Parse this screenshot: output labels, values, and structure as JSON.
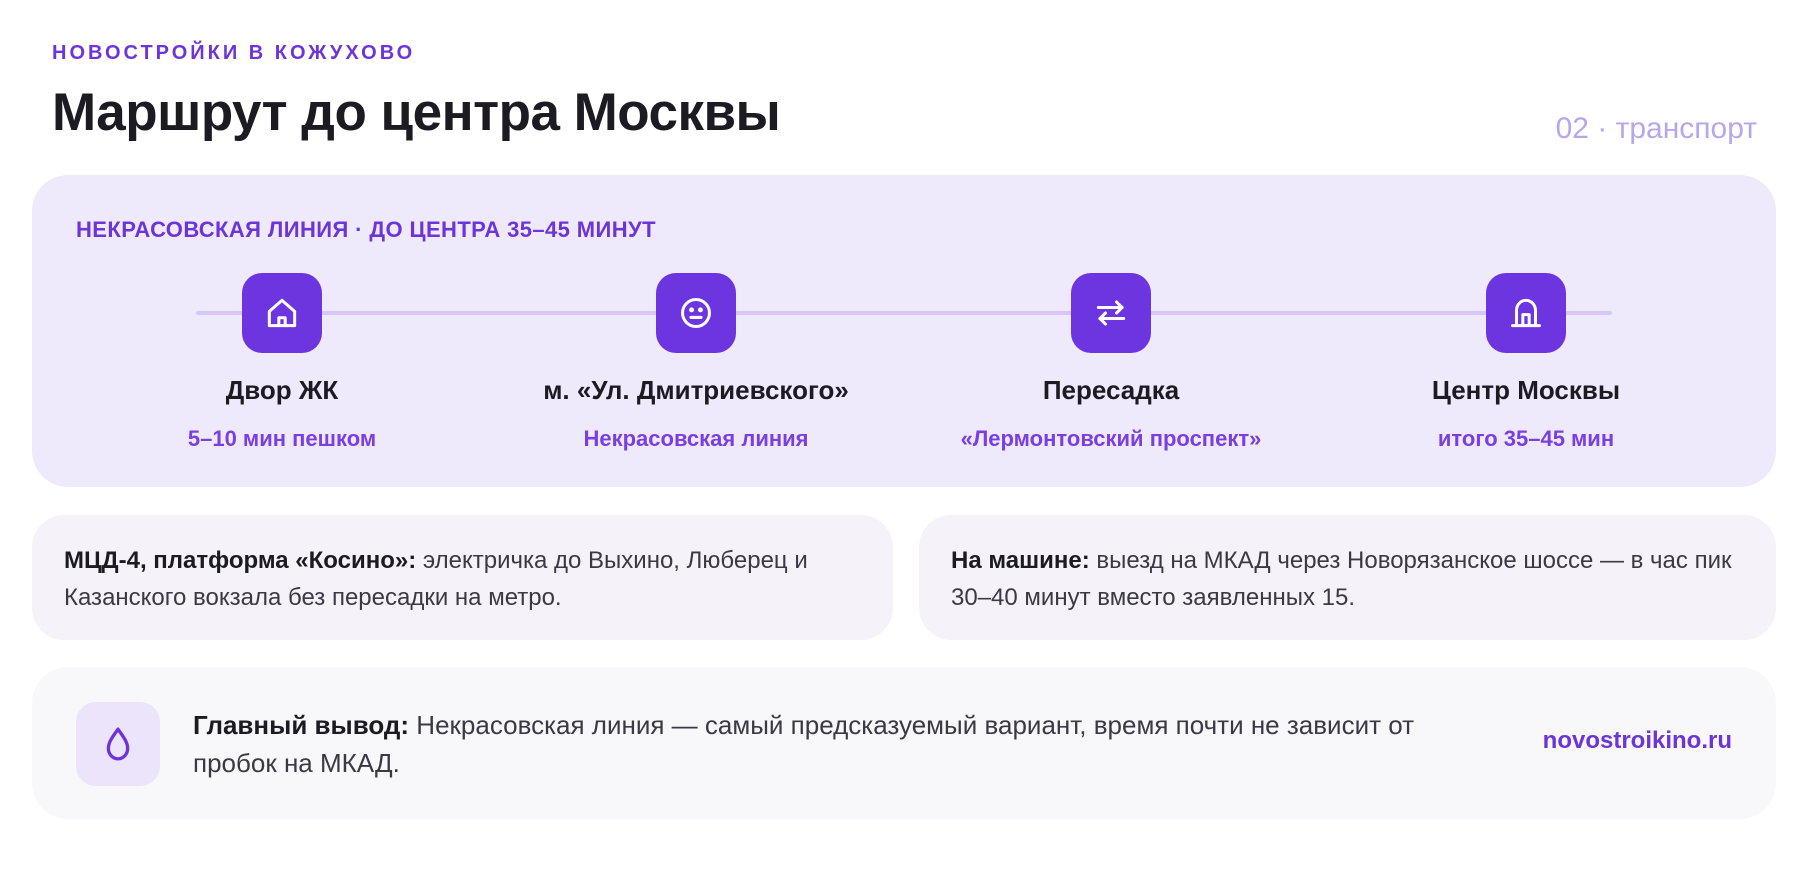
{
  "header": {
    "eyebrow": "НОВОСТРОЙКИ В КОЖУХОВО",
    "title": "Маршрут до центра Москвы",
    "tag": "02 · транспорт"
  },
  "route": {
    "heading": "НЕКРАСОВСКАЯ ЛИНИЯ · ДО ЦЕНТРА 35–45 МИНУТ",
    "steps": [
      {
        "icon": "home-icon",
        "title": "Двор ЖК",
        "subtitle": "5–10 мин пешком"
      },
      {
        "icon": "face-icon",
        "title": "м. «Ул. Дмитриевского»",
        "subtitle": "Некрасовская линия"
      },
      {
        "icon": "transfer-icon",
        "title": "Пересадка",
        "subtitle": "«Лермонтовский проспект»"
      },
      {
        "icon": "landmark-icon",
        "title": "Центр Москвы",
        "subtitle": "итого 35–45 мин"
      }
    ]
  },
  "cards": {
    "left": {
      "label": "МЦД-4, платформа «Косино»:",
      "text": " электричка до Выхино, Люберец и Казанского вокзала без пересадки на метро."
    },
    "right": {
      "label": "На машине:",
      "text": " выезд на МКАД через Новорязанское шоссе — в час пик 30–40 минут вместо заявленных 15."
    }
  },
  "summary": {
    "icon": "drop-icon",
    "label": "Главный вывод:",
    "text": " Некрасовская линия — самый предсказуемый вариант, время почти не зависит от пробок на МКАД.",
    "link": "novostroikino.ru"
  },
  "colors": {
    "accent": "#6d35d8",
    "icon_bg": "#6d35e0",
    "route_bg": "#efe9fc",
    "card_bg": "#f5f3f9",
    "tag": "#b9a6ea"
  }
}
